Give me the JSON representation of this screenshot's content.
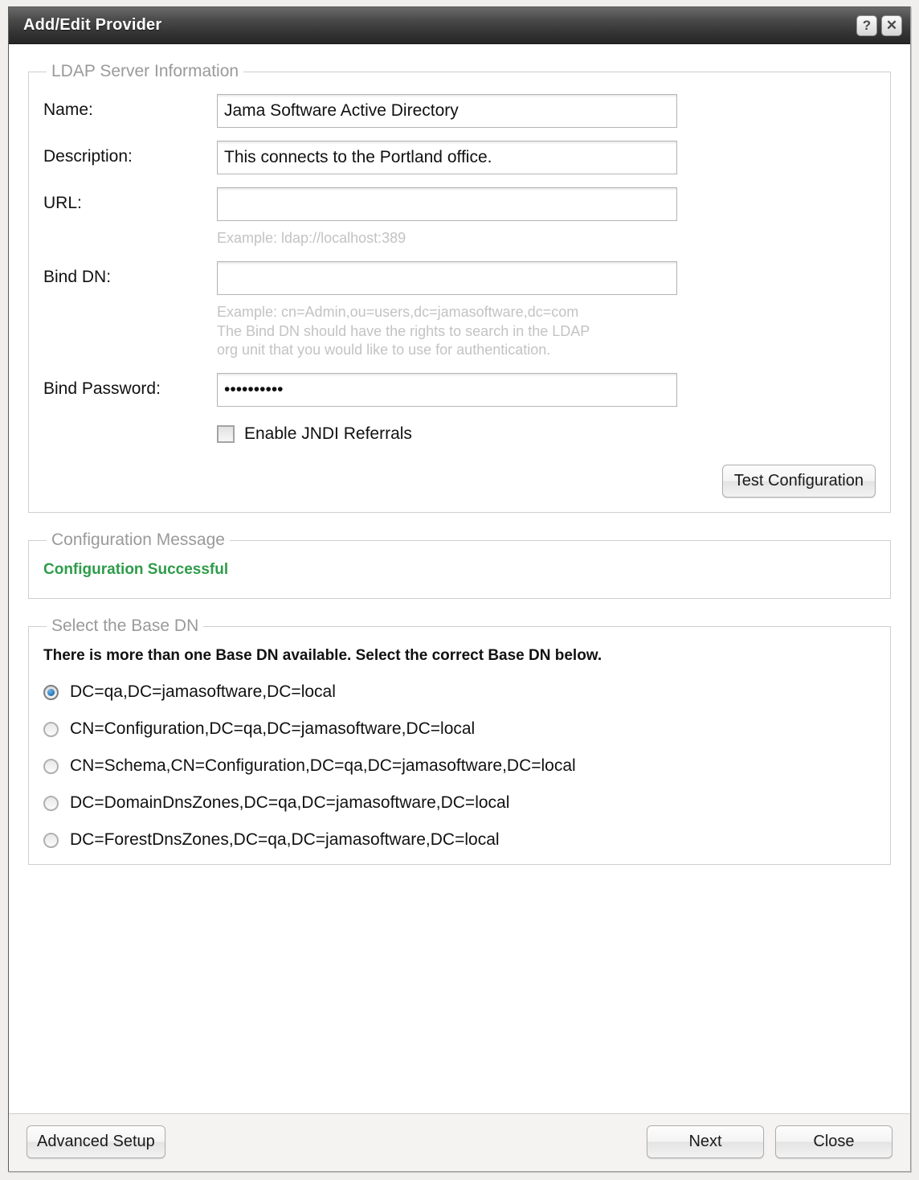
{
  "window": {
    "title": "Add/Edit Provider",
    "help_icon": "question-mark-icon",
    "close_icon": "close-x-icon",
    "help_glyph": "?",
    "close_glyph": "✕"
  },
  "ldap_section": {
    "legend": "LDAP Server Information",
    "fields": [
      {
        "label": "Name:",
        "value": "Jama Software Active Directory",
        "placeholder": "",
        "hint": ""
      },
      {
        "label": "Description:",
        "value": "This connects to the Portland office.",
        "placeholder": "",
        "hint": ""
      },
      {
        "label": "URL:",
        "value": "",
        "placeholder": "",
        "hint": "Example: ldap://localhost:389"
      },
      {
        "label": "Bind DN:",
        "value": "",
        "placeholder": "",
        "hint": "Example: cn=Admin,ou=users,dc=jamasoftware,dc=com\nThe Bind DN should have the rights to search in the LDAP\norg unit that you would like to use for authentication."
      },
      {
        "label": "Bind Password:",
        "value": "••••••••••",
        "placeholder": "",
        "hint": ""
      }
    ],
    "checkbox": {
      "label": "Enable JNDI Referrals",
      "checked": false
    },
    "test_button": "Test Configuration"
  },
  "config_message_section": {
    "legend": "Configuration Message",
    "message": "Configuration Successful",
    "message_color": "#2e9c4a"
  },
  "base_dn_section": {
    "legend": "Select the Base DN",
    "note": "There is more than one Base DN available. Select the correct Base DN below.",
    "options": [
      {
        "label": "DC=qa,DC=jamasoftware,DC=local",
        "selected": true
      },
      {
        "label": "CN=Configuration,DC=qa,DC=jamasoftware,DC=local",
        "selected": false
      },
      {
        "label": "CN=Schema,CN=Configuration,DC=qa,DC=jamasoftware,DC=local",
        "selected": false
      },
      {
        "label": "DC=DomainDnsZones,DC=qa,DC=jamasoftware,DC=local",
        "selected": false
      },
      {
        "label": "DC=ForestDnsZones,DC=qa,DC=jamasoftware,DC=local",
        "selected": false
      }
    ]
  },
  "footer": {
    "advanced_setup": "Advanced Setup",
    "next": "Next",
    "close": "Close"
  }
}
